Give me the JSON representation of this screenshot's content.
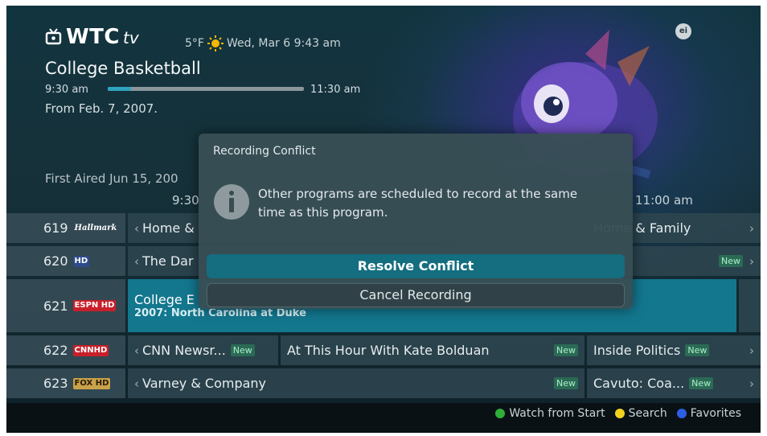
{
  "header": {
    "logo_text": "WTC",
    "logo_suffix": "tv",
    "weather": "5°F",
    "datetime": "Wed, Mar 6 9:43 am",
    "badge": "ei"
  },
  "program": {
    "title": "College Basketball",
    "start_time": "9:30 am",
    "end_time": "11:30 am",
    "progress": 0.12,
    "from": "From Feb. 7, 2007.",
    "first_aired": "First Aired Jun 15, 200"
  },
  "guide": {
    "time_col_1": "9:30",
    "time_col_2": "11:00 am",
    "rows": [
      {
        "channel": "619",
        "logo": "Hallmark",
        "programs": [
          "Home &",
          "Home & Family"
        ]
      },
      {
        "channel": "620",
        "logo": "HD",
        "programs": [
          "The Dar"
        ],
        "new": "New"
      },
      {
        "channel": "621",
        "logo": "ESPN HD",
        "programs": [
          "College E",
          "2007: North Carolina at Duke"
        ]
      },
      {
        "channel": "622",
        "logo": "CNNHD",
        "programs": [
          "CNN Newsr...",
          "At This Hour With Kate Bolduan",
          "Inside Politics"
        ],
        "new": "New"
      },
      {
        "channel": "623",
        "logo": "FOX HD",
        "programs": [
          "Varney & Company",
          "Cavuto: Coa..."
        ],
        "new": "New"
      }
    ]
  },
  "dialog": {
    "title": "Recording Conflict",
    "message": "Other programs are scheduled to record at the same time as this program.",
    "resolve_label": "Resolve Conflict",
    "cancel_label": "Cancel Recording"
  },
  "legend": {
    "items": [
      {
        "label": "Watch from Start",
        "color": "#2fae3a"
      },
      {
        "label": "Search",
        "color": "#f0d21e"
      },
      {
        "label": "Favorites",
        "color": "#2d5fe6"
      }
    ]
  },
  "colors": {
    "accent": "#13778e",
    "button": "#146e7f",
    "new_badge": "#2b6a55"
  }
}
